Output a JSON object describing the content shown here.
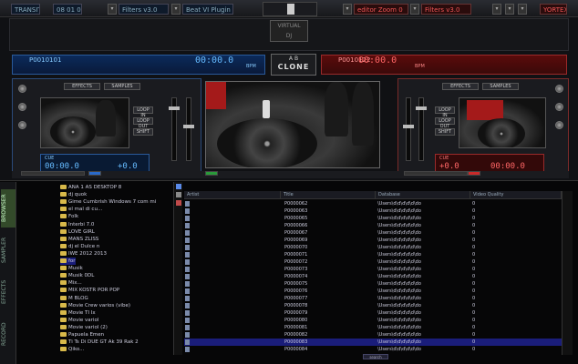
{
  "app": {
    "name": "Virtual DJ"
  },
  "topbar": {
    "left_field_1": "TRANSITIO",
    "left_field_2": "08 01 04",
    "left_effect": "Filters v3.0",
    "left_plugin": "Beat VI Plugin",
    "right_effect": "Filters v3.0",
    "right_plugin": "editor Zoom 0",
    "right_extra": "YORTEX"
  },
  "deck_left": {
    "title": "P0010101",
    "time": "00:00.0",
    "bpm_label": "BPM",
    "effects_label": "EFFECTS",
    "samples_label": "SAMPLES",
    "pitch": "+0.0",
    "pitch_time": "00:00.0",
    "cue_label": "CUE",
    "btn_labels": [
      "LOOP IN",
      "LOOP OUT",
      "SHIFT"
    ]
  },
  "deck_right": {
    "title": "P0010122",
    "time": "00:00.0",
    "bpm_label": "BPM",
    "effects_label": "EFFECTS",
    "samples_label": "SAMPLES",
    "pitch": "+0.0",
    "pitch_time": "00:00.0",
    "cue_label": "CUE",
    "btn_labels": [
      "LOOP IN",
      "LOOP OUT",
      "SHIFT"
    ]
  },
  "clone": {
    "a": "A",
    "b": "B",
    "label": "CLONE"
  },
  "sidetabs": [
    "BROWSER",
    "SAMPLER",
    "EFFECTS",
    "RECORD"
  ],
  "sidetab_active": 0,
  "tree": [
    "ANA 1 AS DESKTOP 8",
    "dj quok",
    "Gime Cumbrish Windows 7 com mi",
    "el mal di cu...",
    "Folk",
    "Interbi 7.0",
    "LOVE GIRL",
    "MANS ZLISS",
    "dj el Dulce n",
    "IWE 2012 2013",
    "for",
    "Musik",
    "Musik 0DL",
    "Mix...",
    "MIX KOSTR POR POP",
    "M BLOG",
    "Movie Crew varios (vibe)",
    "Movie TI Ix",
    "Movie variol",
    "Movie variol (2)",
    "Papuela Emen",
    "Ti Ts Di DUE GT Ak 39 Rak 2",
    "Qiko..."
  ],
  "tree_selected": 10,
  "list": {
    "headers": [
      "Artist",
      "Title",
      "Database",
      "Video Quality"
    ],
    "rows": [
      {
        "title": "P0000062",
        "db": "\\Users\\d\\d\\d\\d\\d\\do",
        "q": "0"
      },
      {
        "title": "P0000063",
        "db": "\\Users\\d\\d\\d\\d\\d\\do",
        "q": "0"
      },
      {
        "title": "P0000065",
        "db": "\\Users\\d\\d\\d\\d\\d\\do",
        "q": "0"
      },
      {
        "title": "P0000066",
        "db": "\\Users\\d\\d\\d\\d\\d\\do",
        "q": "0"
      },
      {
        "title": "P0000067",
        "db": "\\Users\\d\\d\\d\\d\\d\\do",
        "q": "0"
      },
      {
        "title": "P0000069",
        "db": "\\Users\\d\\d\\d\\d\\d\\do",
        "q": "0"
      },
      {
        "title": "P0000070",
        "db": "\\Users\\d\\d\\d\\d\\d\\do",
        "q": "0"
      },
      {
        "title": "P0000071",
        "db": "\\Users\\d\\d\\d\\d\\d\\do",
        "q": "0"
      },
      {
        "title": "P0000072",
        "db": "\\Users\\d\\d\\d\\d\\d\\do",
        "q": "0"
      },
      {
        "title": "P0000073",
        "db": "\\Users\\d\\d\\d\\d\\d\\do",
        "q": "0"
      },
      {
        "title": "P0000074",
        "db": "\\Users\\d\\d\\d\\d\\d\\do",
        "q": "0"
      },
      {
        "title": "P0000075",
        "db": "\\Users\\d\\d\\d\\d\\d\\do",
        "q": "0"
      },
      {
        "title": "P0000076",
        "db": "\\Users\\d\\d\\d\\d\\d\\do",
        "q": "0"
      },
      {
        "title": "P0000077",
        "db": "\\Users\\d\\d\\d\\d\\d\\do",
        "q": "0"
      },
      {
        "title": "P0000078",
        "db": "\\Users\\d\\d\\d\\d\\d\\do",
        "q": "0"
      },
      {
        "title": "P0000079",
        "db": "\\Users\\d\\d\\d\\d\\d\\do",
        "q": "0"
      },
      {
        "title": "P0000080",
        "db": "\\Users\\d\\d\\d\\d\\d\\do",
        "q": "0"
      },
      {
        "title": "P0000081",
        "db": "\\Users\\d\\d\\d\\d\\d\\do",
        "q": "0"
      },
      {
        "title": "P0000082",
        "db": "\\Users\\d\\d\\d\\d\\d\\do",
        "q": "0"
      },
      {
        "title": "P0000083",
        "db": "\\Users\\d\\d\\d\\d\\d\\do",
        "q": "0"
      },
      {
        "title": "P0000084",
        "db": "\\Users\\d\\d\\d\\d\\d\\do",
        "q": "0"
      }
    ],
    "selected": 19
  },
  "search": {
    "value": "search"
  },
  "colors": {
    "left_accent": "#3a8aff",
    "right_accent": "#ff3a3a",
    "selection": "#1a1d7a"
  }
}
